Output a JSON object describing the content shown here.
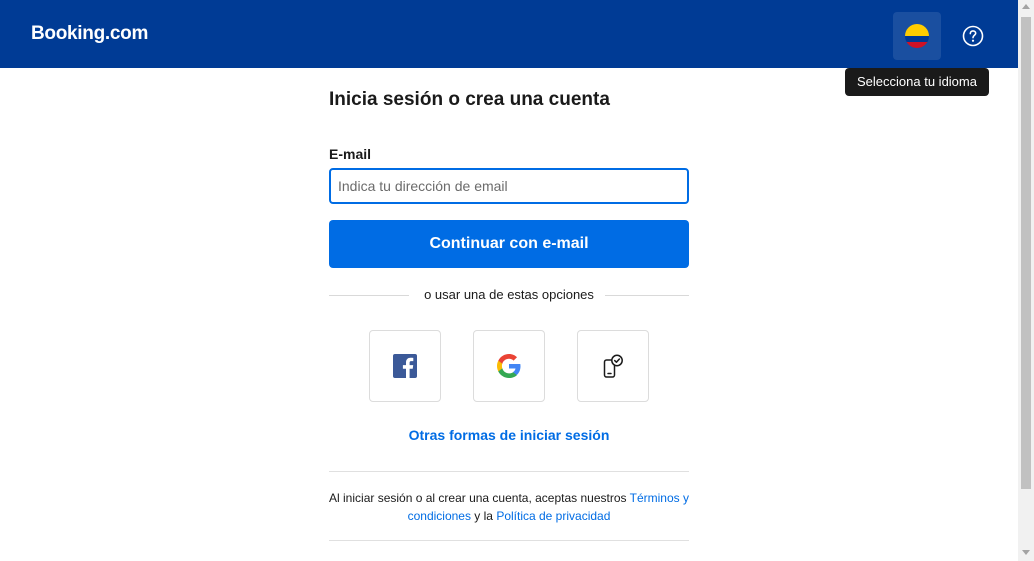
{
  "header": {
    "logo": "Booking.com",
    "language_icon": "colombia-flag-icon",
    "help_icon": "question-circle-icon",
    "tooltip": "Selecciona tu idioma",
    "colors": {
      "background": "#003b95",
      "flag_button": "#1a4fa0"
    }
  },
  "form": {
    "title": "Inicia sesión o crea una cuenta",
    "email_label": "E-mail",
    "email_placeholder": "Indica tu dirección de email",
    "email_value": "",
    "continue_label": "Continuar con e-mail",
    "divider_text": "o usar una de estas opciones",
    "social_buttons": [
      {
        "name": "facebook",
        "icon": "facebook-icon"
      },
      {
        "name": "google",
        "icon": "google-icon"
      },
      {
        "name": "device",
        "icon": "phone-check-icon"
      }
    ],
    "other_options_link": "Otras formas de iniciar sesión",
    "colors": {
      "primary": "#006ce4"
    }
  },
  "terms": {
    "prefix": "Al iniciar sesión o al crear una cuenta, aceptas nuestros ",
    "terms_link": "Términos y condiciones",
    "connector": " y la ",
    "privacy_link": "Política de privacidad"
  }
}
